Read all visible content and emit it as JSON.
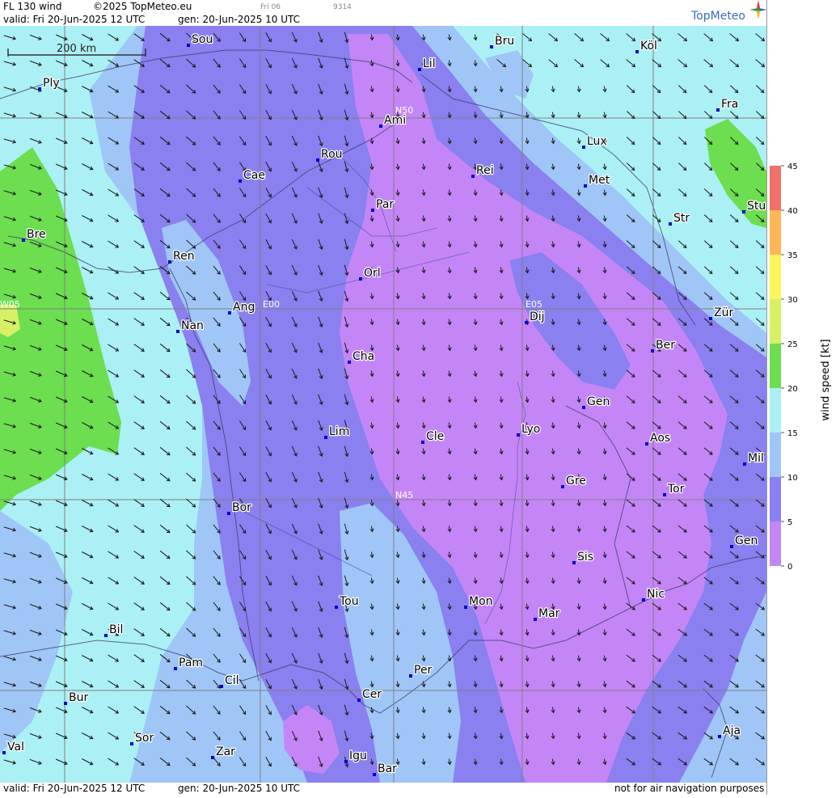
{
  "header": {
    "product": "FL 130 wind",
    "copyright": "©2025 TopMeteo.eu",
    "run_tag": "Fri 06",
    "run_code": "9314",
    "valid": "valid:  Fri  20-Jun-2025  12 UTC",
    "generated": "gen: 20-Jun-2025 10 UTC",
    "logo": "TopMeteo"
  },
  "footer": {
    "valid": "valid:  Fri  20-Jun-2025  12 UTC",
    "generated": "gen: 20-Jun-2025 10 UTC",
    "disclaimer": "not for air navigation purposes"
  },
  "scale_bar": {
    "label": "200 km"
  },
  "legend": {
    "title": "wind  speed  [kt]",
    "ticks": [
      "45",
      "40",
      "35",
      "30",
      "25",
      "20",
      "15",
      "10",
      "5",
      "0"
    ],
    "colors": {
      "0-5": "#c486f7",
      "5-10": "#8a80ef",
      "10-15": "#9fc6f7",
      "15-20": "#abf0f5",
      "20-25": "#6cde50",
      "25-30": "#d8f066",
      "30-35": "#fff55c",
      "35-40": "#ffb755",
      "40-45": "#f0706a"
    }
  },
  "grid_labels": [
    "N50",
    "N45",
    "W05",
    "E00",
    "E05"
  ],
  "cities": [
    {
      "name": "Sou"
    },
    {
      "name": "Bru"
    },
    {
      "name": "Köl"
    },
    {
      "name": "Lil"
    },
    {
      "name": "Ply"
    },
    {
      "name": "Ami"
    },
    {
      "name": "Fra"
    },
    {
      "name": "Lux"
    },
    {
      "name": "Rou"
    },
    {
      "name": "Rei"
    },
    {
      "name": "Cae"
    },
    {
      "name": "Met"
    },
    {
      "name": "Par"
    },
    {
      "name": "Stu"
    },
    {
      "name": "Bre"
    },
    {
      "name": "Str"
    },
    {
      "name": "Ren"
    },
    {
      "name": "Orl"
    },
    {
      "name": "Ang"
    },
    {
      "name": "Dij"
    },
    {
      "name": "Zür"
    },
    {
      "name": "Nan"
    },
    {
      "name": "Ber"
    },
    {
      "name": "Cha"
    },
    {
      "name": "Gen"
    },
    {
      "name": "Lim"
    },
    {
      "name": "Cle"
    },
    {
      "name": "Lyo"
    },
    {
      "name": "Aos"
    },
    {
      "name": "Mil"
    },
    {
      "name": "Gre"
    },
    {
      "name": "Tor"
    },
    {
      "name": "Bor"
    },
    {
      "name": "Gen"
    },
    {
      "name": "Sis"
    },
    {
      "name": "Tou"
    },
    {
      "name": "Mon"
    },
    {
      "name": "Nic"
    },
    {
      "name": "Mar"
    },
    {
      "name": "Bil"
    },
    {
      "name": "Pam"
    },
    {
      "name": "Per"
    },
    {
      "name": "Cil"
    },
    {
      "name": "Bur"
    },
    {
      "name": "Cer"
    },
    {
      "name": "Sor"
    },
    {
      "name": "Aja"
    },
    {
      "name": "Val"
    },
    {
      "name": "Zar"
    },
    {
      "name": "Igu"
    },
    {
      "name": "Bar"
    }
  ]
}
